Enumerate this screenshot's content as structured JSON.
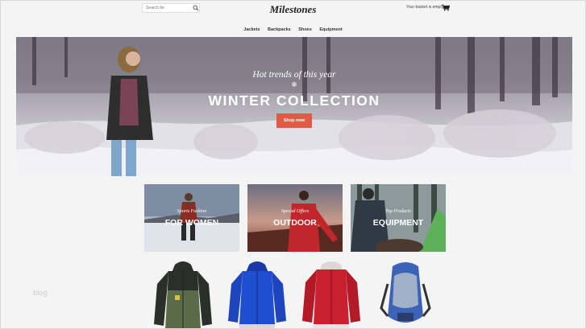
{
  "header": {
    "search_placeholder": "Search for",
    "logo": "Milestones",
    "basket_text": "Your basket is empty"
  },
  "nav": {
    "items": [
      {
        "label": "Jackets"
      },
      {
        "label": "Backpacks"
      },
      {
        "label": "Shoes"
      },
      {
        "label": "Equipment"
      }
    ]
  },
  "hero": {
    "subtitle": "Hot trends of this year",
    "title": "WINTER COLLECTION",
    "button": "Shop now",
    "button_color": "#e05a46"
  },
  "categories": [
    {
      "subtitle": "Sports Fashion",
      "title": "FOR WOMEN"
    },
    {
      "subtitle": "Special Offers",
      "title": "OUTDOOR"
    },
    {
      "subtitle": "Top Products",
      "title": "EQUIPMENT"
    }
  ],
  "products": [
    {
      "name": "green-jacket",
      "color": "#5b6b4a"
    },
    {
      "name": "blue-jacket",
      "color": "#1f4fd0"
    },
    {
      "name": "red-jacket",
      "color": "#c8202e"
    },
    {
      "name": "blue-backpack",
      "color": "#3c63b8"
    }
  ],
  "footer": {
    "blog_label": "blog"
  },
  "icons": [
    "search-icon",
    "cart-icon",
    "snowflake-icon"
  ]
}
